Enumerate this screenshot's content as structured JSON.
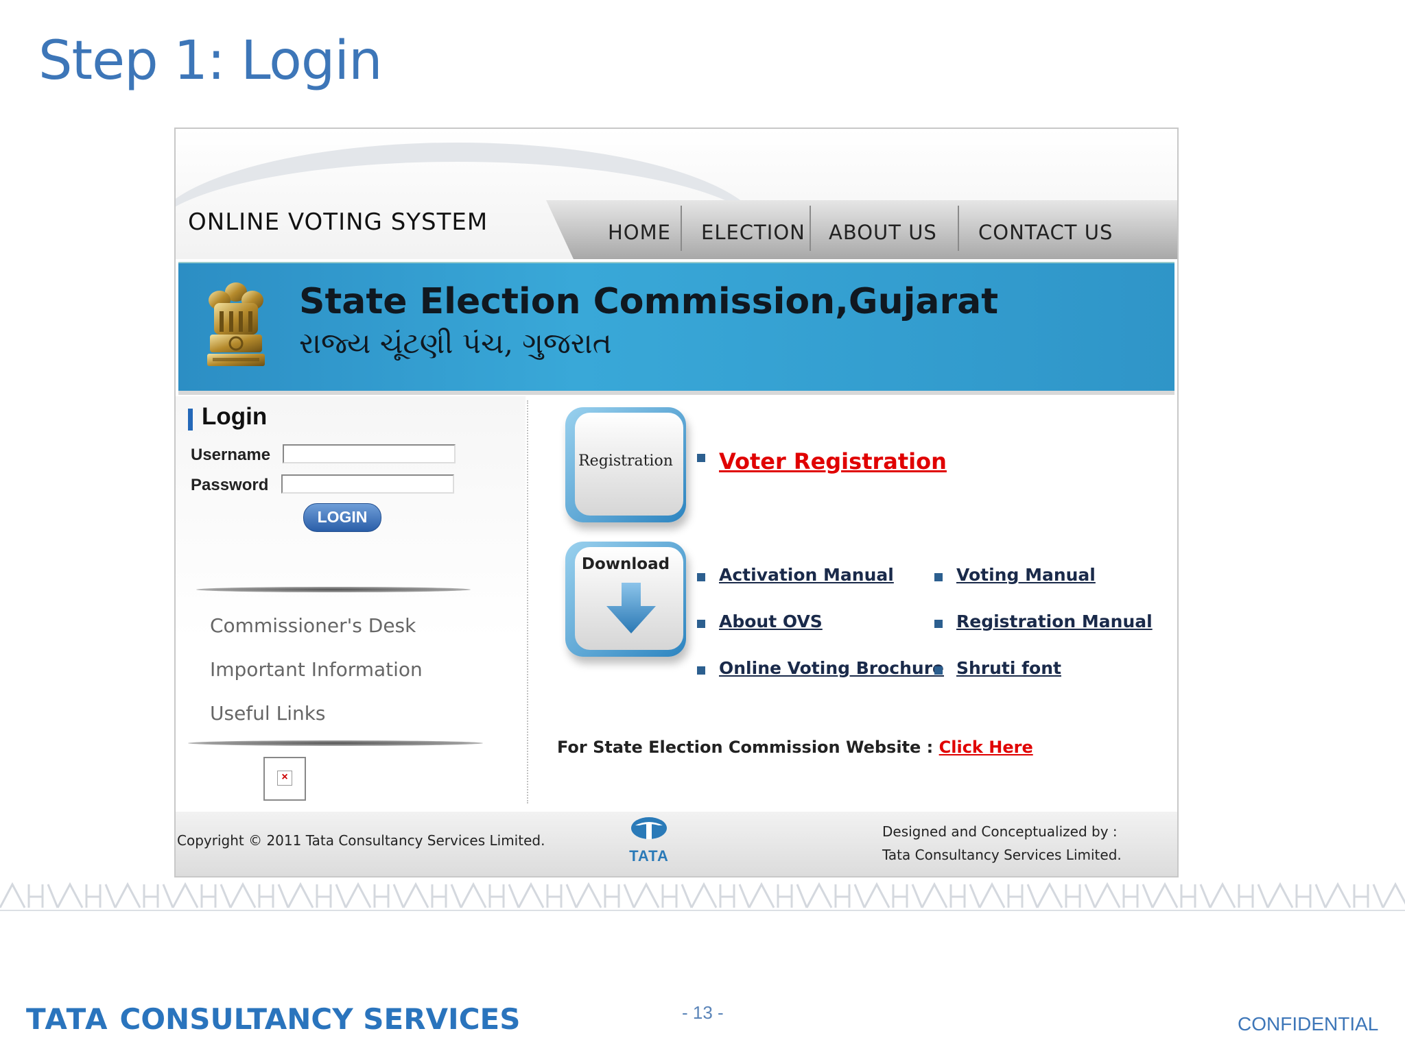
{
  "slide": {
    "title": "Step 1: Login",
    "footer_brand_tata": "TATA",
    "footer_brand_rest": "CONSULTANCY SERVICES",
    "page_number": "- 13 -",
    "confidential": "CONFIDENTIAL"
  },
  "app": {
    "system_title": "ONLINE VOTING SYSTEM",
    "nav": [
      "HOME",
      "ELECTION",
      "ABOUT US",
      "CONTACT US"
    ],
    "banner_title": "State Election Commission,Gujarat",
    "banner_subtitle": "રાજ્ય ચૂંટણી પંચ, ગુજરાત"
  },
  "login": {
    "heading": "Login",
    "username_label": "Username",
    "username_value": "",
    "password_label": "Password",
    "password_value": "",
    "button": "LOGIN"
  },
  "sidebar": {
    "items": [
      "Commissioner's Desk",
      "Important Information",
      "Useful Links"
    ]
  },
  "registration": {
    "icon_label": "Registration",
    "link": "Voter Registration"
  },
  "downloads": {
    "icon_label": "Download",
    "links": [
      "Activation Manual",
      "Voting Manual",
      "About OVS",
      "Registration Manual",
      "Online Voting Brochure",
      "Shruti font"
    ]
  },
  "website": {
    "text": "For State Election Commission Website : ",
    "link": "Click Here"
  },
  "footer": {
    "copyright": "Copyright © 2011 Tata Consultancy Services Limited.",
    "logo_text": "TATA",
    "designed_line1": "Designed and Conceptualized by :",
    "designed_line2": "Tata Consultancy Services Limited."
  },
  "colors": {
    "title_blue": "#3d76b8",
    "banner_blue": "#39a8d8",
    "link_red": "#e00000"
  }
}
